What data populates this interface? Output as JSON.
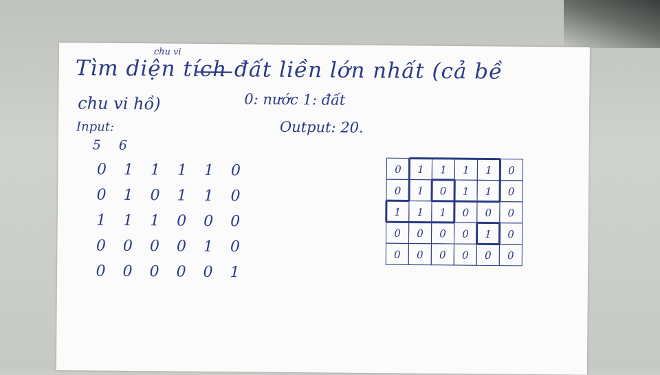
{
  "title": {
    "line1": "Tìm diện tích đất liền lớn nhất (cả bề",
    "line2": "chu vi hồ)",
    "correction": "chu vi"
  },
  "legend": "0: nước   1: đất",
  "input_label": "Input:",
  "dims": "5 6",
  "matrix": [
    [
      "0",
      "1",
      "1",
      "1",
      "1",
      "0"
    ],
    [
      "0",
      "1",
      "0",
      "1",
      "1",
      "0"
    ],
    [
      "1",
      "1",
      "1",
      "0",
      "0",
      "0"
    ],
    [
      "0",
      "0",
      "0",
      "0",
      "1",
      "0"
    ],
    [
      "0",
      "0",
      "0",
      "0",
      "0",
      "1"
    ]
  ],
  "output_label": "Output: 20.",
  "grid": [
    [
      "0",
      "1",
      "1",
      "1",
      "1",
      "0"
    ],
    [
      "0",
      "1",
      "0",
      "1",
      "1",
      "0"
    ],
    [
      "1",
      "1",
      "1",
      "0",
      "0",
      "0"
    ],
    [
      "0",
      "0",
      "0",
      "0",
      "1",
      "0"
    ],
    [
      "0",
      "0",
      "0",
      "0",
      "0",
      "0"
    ]
  ],
  "colors": {
    "ink": "#2b3a86",
    "paper": "#fbfbfb",
    "desk": "#c9ccc7"
  }
}
